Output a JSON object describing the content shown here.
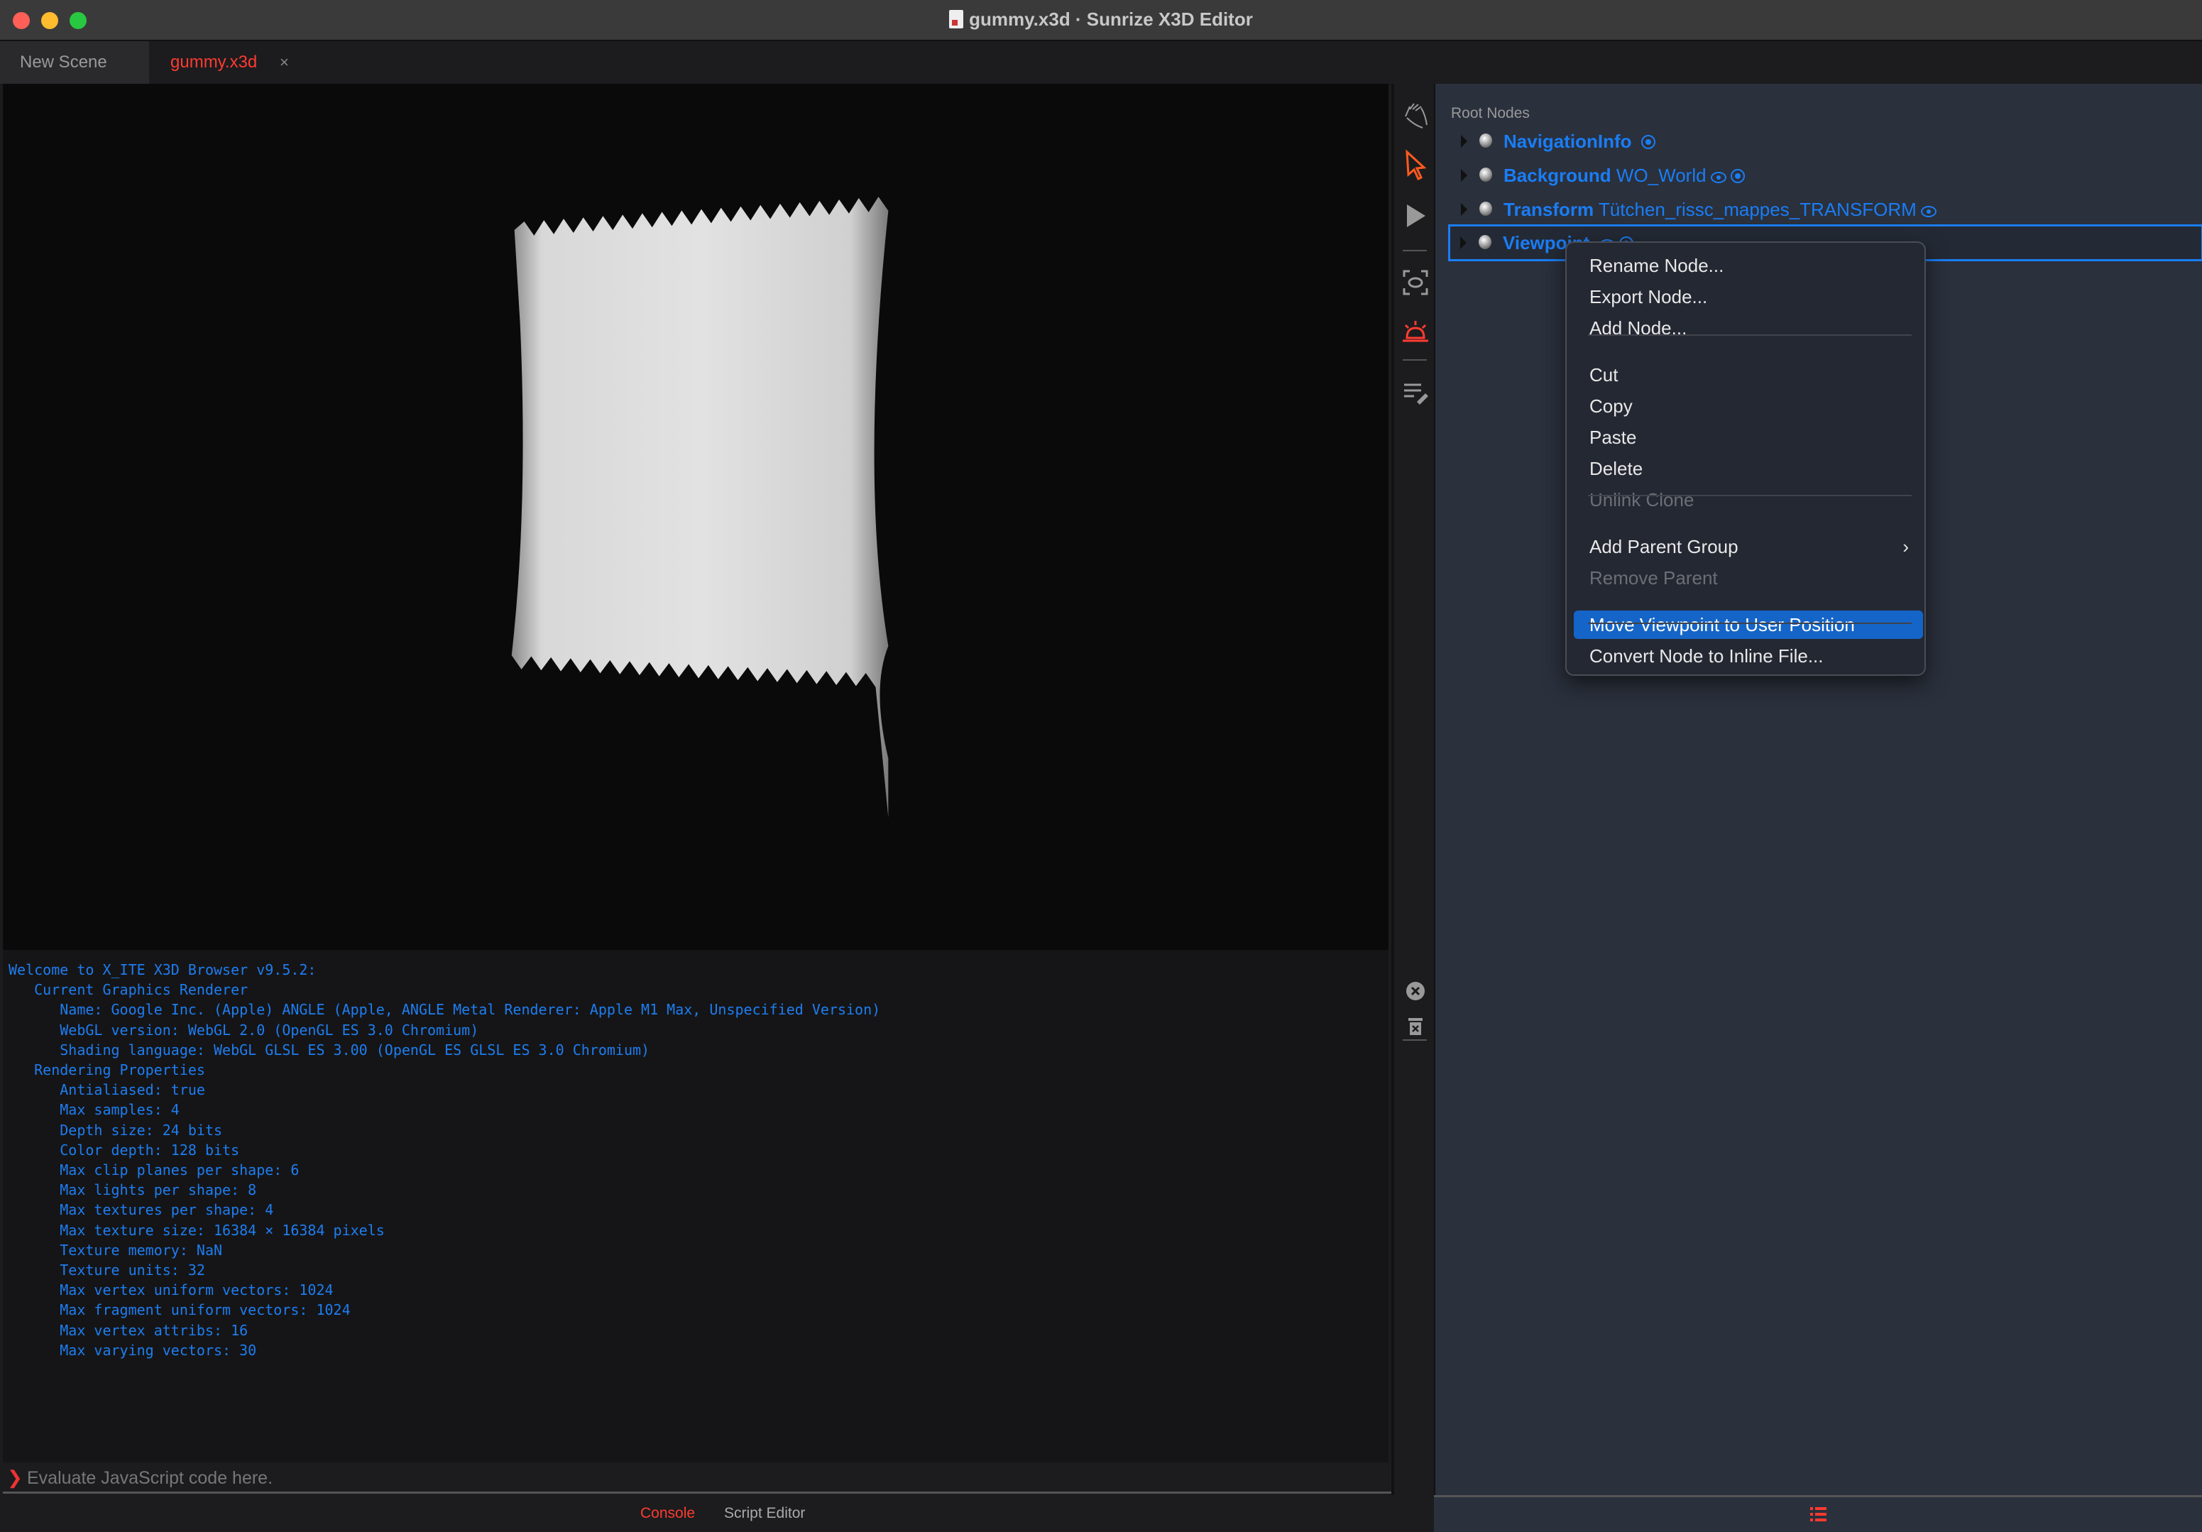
{
  "window": {
    "title": "gummy.x3d · Sunrize X3D Editor"
  },
  "tabs": [
    {
      "label": "New Scene"
    },
    {
      "label": "gummy.x3d",
      "close": "×",
      "active": true
    }
  ],
  "colors": {
    "accent": "#1a7df5",
    "active_tab": "#ff3b30",
    "highlight": "#1565c8"
  },
  "toolbar": {
    "icons": [
      "hand-icon",
      "select-arrow-icon",
      "play-icon",
      "viewpoint-focus-icon",
      "alarm-light-icon",
      "edit-list-icon"
    ],
    "console_icons": [
      "clear-console-icon",
      "trash-icon"
    ]
  },
  "console": {
    "lines": [
      "Welcome to X_ITE X3D Browser v9.5.2:",
      "   Current Graphics Renderer",
      "      Name: Google Inc. (Apple) ANGLE (Apple, ANGLE Metal Renderer: Apple M1 Max, Unspecified Version)",
      "      WebGL version: WebGL 2.0 (OpenGL ES 3.0 Chromium)",
      "      Shading language: WebGL GLSL ES 3.00 (OpenGL ES GLSL ES 3.0 Chromium)",
      "   Rendering Properties",
      "      Antialiased: true",
      "      Max samples: 4",
      "      Depth size: 24 bits",
      "      Color depth: 128 bits",
      "      Max clip planes per shape: 6",
      "      Max lights per shape: 8",
      "      Max textures per shape: 4",
      "      Max texture size: 16384 × 16384 pixels",
      "      Texture memory: NaN",
      "      Texture units: 32",
      "      Max vertex uniform vectors: 1024",
      "      Max fragment uniform vectors: 1024",
      "      Max vertex attribs: 16",
      "      Max varying vectors: 30"
    ],
    "input_placeholder": "Evaluate JavaScript code here.",
    "prompt": "❯"
  },
  "bottom_tabs": {
    "console": "Console",
    "script_editor": "Script Editor"
  },
  "outline": {
    "root_label": "Root Nodes",
    "nodes": [
      {
        "type": "NavigationInfo",
        "name": ""
      },
      {
        "type": "Background",
        "name": "WO_World"
      },
      {
        "type": "Transform",
        "name": "Tütchen_rissc_mappes_TRANSFORM"
      },
      {
        "type": "Viewpoint",
        "name": ""
      }
    ]
  },
  "context_menu": {
    "items": [
      {
        "label": "Rename Node..."
      },
      {
        "label": "Export Node..."
      },
      {
        "label": "Add Node..."
      },
      {
        "label": "Cut"
      },
      {
        "label": "Copy"
      },
      {
        "label": "Paste"
      },
      {
        "label": "Delete"
      },
      {
        "label": "Unlink Clone",
        "disabled": true
      },
      {
        "label": "Add Parent Group",
        "submenu": "›"
      },
      {
        "label": "Remove Parent",
        "disabled": true
      },
      {
        "label": "Move Viewpoint to User Position",
        "highlighted": true
      },
      {
        "label": "Convert Node to Inline File..."
      }
    ]
  }
}
